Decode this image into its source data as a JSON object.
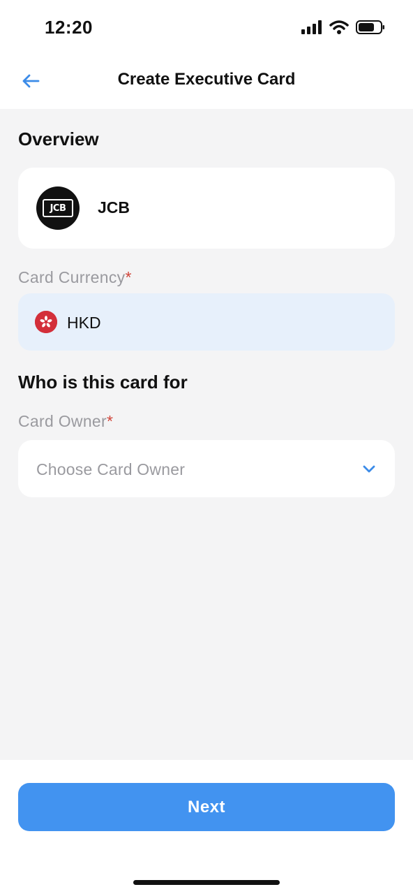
{
  "status_bar": {
    "time": "12:20",
    "icons": [
      "signal-icon",
      "wifi-icon",
      "battery-icon"
    ]
  },
  "nav": {
    "back_icon": "arrow-left-icon",
    "title": "Create Executive Card"
  },
  "overview": {
    "section_title": "Overview",
    "card_brand_logo": "jcb-logo",
    "card_brand_logo_text": "JCB",
    "card_brand": "JCB"
  },
  "currency": {
    "label": "Card Currency",
    "required_mark": "*",
    "flag_icon": "hong-kong-flag-icon",
    "value": "HKD"
  },
  "owner_section": {
    "section_title": "Who is this card for",
    "label": "Card Owner",
    "required_mark": "*",
    "placeholder": "Choose Card Owner",
    "dropdown_icon": "chevron-down-icon"
  },
  "footer": {
    "next_label": "Next"
  },
  "colors": {
    "accent": "#4293f0",
    "required": "#d0453a",
    "currency_bg": "#e7f0fb",
    "page_bg": "#f4f4f5"
  }
}
